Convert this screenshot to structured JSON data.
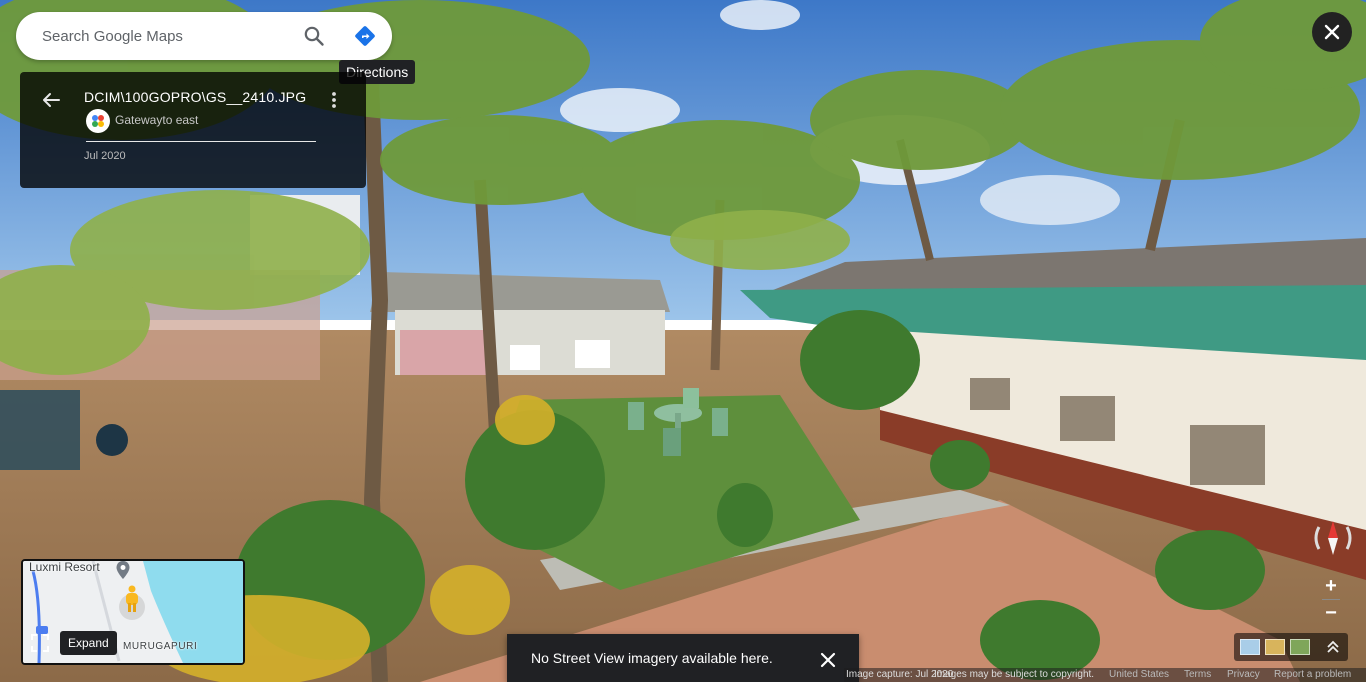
{
  "search": {
    "placeholder": "Search Google Maps",
    "directions_tooltip": "Directions"
  },
  "photo_card": {
    "title": "DCIM\\100GOPRO\\GS__2410.JPG",
    "contributor": "Gatewayto east",
    "date": "Jul 2020"
  },
  "minimap": {
    "place_label": "Luxmi Resort",
    "area_label": "MURUGAPURI",
    "expand_tooltip": "Expand"
  },
  "snackbar": {
    "message": "No Street View imagery available here."
  },
  "footer": {
    "capture": "Image capture: Jul 2020",
    "copyright": "Images may be subject to copyright.",
    "country": "United States",
    "terms": "Terms",
    "privacy": "Privacy",
    "report": "Report a problem"
  },
  "controls": {
    "zoom_in": "+",
    "zoom_out": "−"
  },
  "icons": {
    "search": "search-icon",
    "directions": "directions-icon",
    "back": "back-arrow-icon",
    "more": "more-vert-icon",
    "close": "close-icon",
    "compass": "compass-icon",
    "pegman": "pegman-icon",
    "expand": "fullscreen-icon",
    "layers": "layers-icon"
  },
  "colors": {
    "directions_blue": "#1a73e8",
    "card_bg": "#000000",
    "snackbar_bg": "#202124",
    "compass_red": "#e53935"
  }
}
